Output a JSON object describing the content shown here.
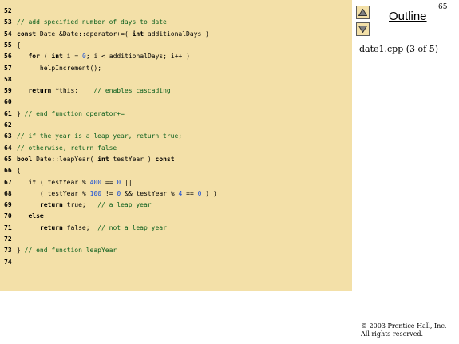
{
  "page_number": "65",
  "outline_label": "Outline",
  "subtitle": "date1.cpp (3 of 5)",
  "copyright": [
    "© 2003 Prentice Hall, Inc.",
    "All rights reserved."
  ],
  "code_lines": [
    {
      "num": "52",
      "text": ""
    },
    {
      "num": "53",
      "text": "// add specified number of days to date"
    },
    {
      "num": "54",
      "text": "const Date &Date::operator+=( int additionalDays )"
    },
    {
      "num": "55",
      "text": "{"
    },
    {
      "num": "56",
      "text": "   for ( int i = 0; i < additionalDays; i++ )"
    },
    {
      "num": "57",
      "text": "      helpIncrement();"
    },
    {
      "num": "58",
      "text": ""
    },
    {
      "num": "59",
      "text": "   return *this;    // enables cascading"
    },
    {
      "num": "60",
      "text": ""
    },
    {
      "num": "61",
      "text": "} // end function operator+="
    },
    {
      "num": "62",
      "text": ""
    },
    {
      "num": "63",
      "text": "// if the year is a leap year, return true;"
    },
    {
      "num": "64",
      "text": "// otherwise, return false"
    },
    {
      "num": "65",
      "text": "bool Date::leapYear( int testYear ) const"
    },
    {
      "num": "66",
      "text": "{"
    },
    {
      "num": "67",
      "text": "   if ( testYear % 400 == 0 ||"
    },
    {
      "num": "68",
      "text": "      ( testYear % 100 != 0 && testYear % 4 == 0 ) )"
    },
    {
      "num": "69",
      "text": "      return true;   // a leap year"
    },
    {
      "num": "70",
      "text": "   else"
    },
    {
      "num": "71",
      "text": "      return false;  // not a leap year"
    },
    {
      "num": "72",
      "text": ""
    },
    {
      "num": "73",
      "text": "} // end function leapYear"
    },
    {
      "num": "74",
      "text": ""
    }
  ],
  "nav": {
    "up_icon": "triangle-up-icon",
    "down_icon": "triangle-down-icon"
  },
  "colors": {
    "panel": "#f3e0a8",
    "comment": "#0b5e1c",
    "number": "#1a4fd6"
  }
}
